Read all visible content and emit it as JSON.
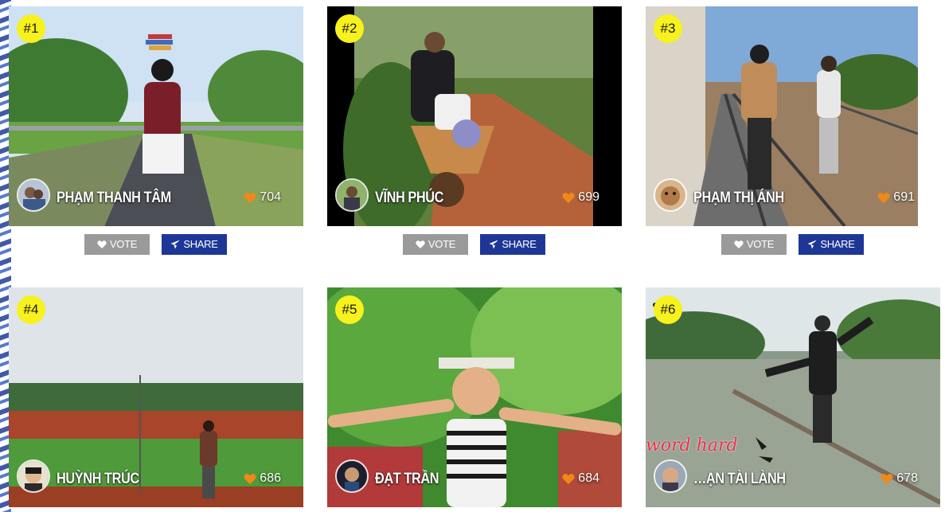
{
  "colors": {
    "rank_badge": "#f7f11e",
    "vote_button": "#9a9a9a",
    "share_button": "#1e3796",
    "heart": "#f0881a"
  },
  "buttons": {
    "vote_label": "VOTE",
    "share_label": "SHARE"
  },
  "entries": [
    {
      "rank": "#1",
      "name": "PHẠM THANH TÂM",
      "likes": "704"
    },
    {
      "rank": "#2",
      "name": "VĨNH PHÚC",
      "likes": "699"
    },
    {
      "rank": "#3",
      "name": "PHẠM THỊ ÁNH",
      "likes": "691"
    },
    {
      "rank": "#4",
      "name": "HUỲNH TRÚC",
      "likes": "686"
    },
    {
      "rank": "#5",
      "name": "ĐẠT TRẦN",
      "likes": "684"
    },
    {
      "rank": "#6",
      "name": "…ẠN TÀI LÀNH",
      "likes": "678",
      "overlay_text": "word hard"
    }
  ]
}
